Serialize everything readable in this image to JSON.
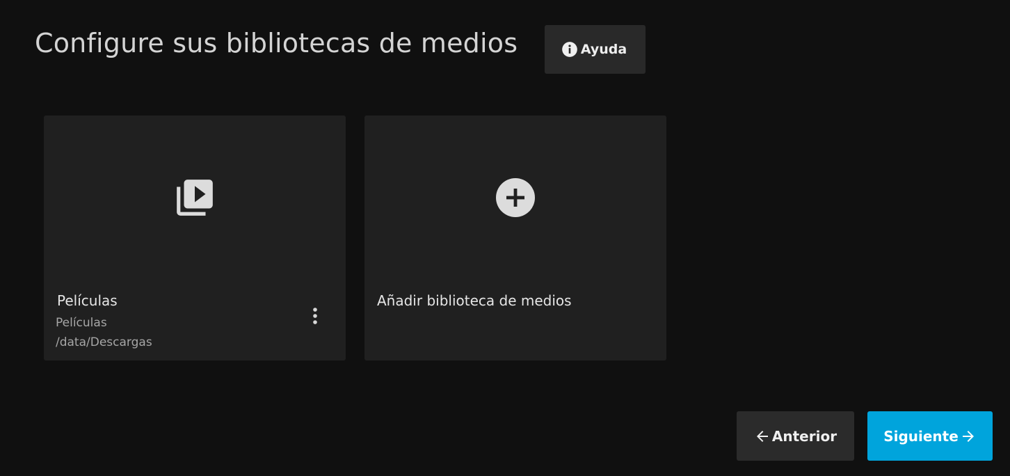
{
  "header": {
    "title": "Configure sus bibliotecas de medios",
    "help_label": "Ayuda",
    "help_icon": "info-circle-icon"
  },
  "libraries": [
    {
      "icon": "video-library-icon",
      "name": "Películas",
      "type": "Películas",
      "path": "/data/Descargas",
      "menu_icon": "more-vertical-icon"
    }
  ],
  "add_card": {
    "icon": "add-circle-icon",
    "label": "Añadir biblioteca de medios"
  },
  "footer": {
    "previous_label": "Anterior",
    "previous_icon": "arrow-left-icon",
    "next_label": "Siguiente",
    "next_icon": "arrow-right-icon"
  },
  "colors": {
    "background": "#101010",
    "card": "#202020",
    "button": "#2b2b2b",
    "accent": "#00a4dc"
  }
}
